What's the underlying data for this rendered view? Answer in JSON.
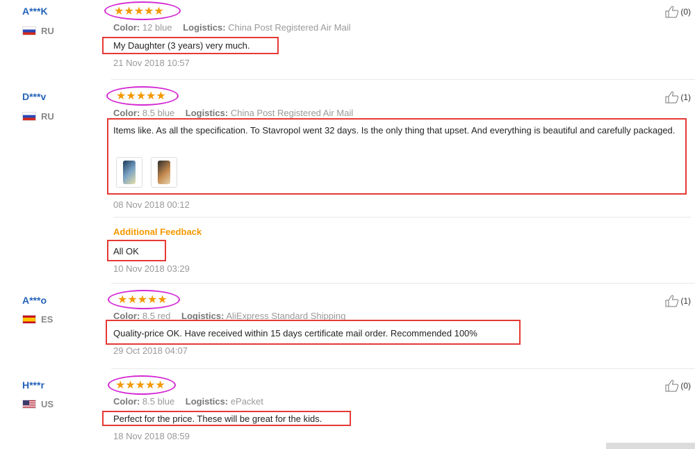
{
  "reviews": [
    {
      "name": "A***K",
      "country": "RU",
      "color_label": "Color:",
      "color_value": "12 blue",
      "logistics_label": "Logistics:",
      "logistics_value": "China Post Registered Air Mail",
      "text": "My Daughter (3 years) very much.",
      "date": "21 Nov 2018 10:57",
      "helpful": "(0)",
      "stars": "★★★★★"
    },
    {
      "name": "D***v",
      "country": "RU",
      "color_label": "Color:",
      "color_value": "8.5 blue",
      "logistics_label": "Logistics:",
      "logistics_value": "China Post Registered Air Mail",
      "text": "Items like. As all the specification. To Stavropol went 32 days. Is the only thing that upset. And everything is beautiful and carefully packaged.",
      "date": "08 Nov 2018 00:12",
      "helpful": "(1)",
      "stars": "★★★★★",
      "additional_label": "Additional Feedback",
      "additional_text": "All OK",
      "additional_date": "10 Nov 2018 03:29"
    },
    {
      "name": "A***o",
      "country": "ES",
      "color_label": "Color:",
      "color_value": "8.5 red",
      "logistics_label": "Logistics:",
      "logistics_value": "AliExpress Standard Shipping",
      "text": "Quality-price OK. Have received within 15 days certificate mail order. Recommended 100%",
      "date": "29 Oct 2018 04:07",
      "helpful": "(1)",
      "stars": "★★★★★"
    },
    {
      "name": "H***r",
      "country": "US",
      "color_label": "Color:",
      "color_value": "8.5 blue",
      "logistics_label": "Logistics:",
      "logistics_value": "ePacket",
      "text": "Perfect for the price. These will be great for the kids.",
      "date": "18 Nov 2018 08:59",
      "helpful": "(0)",
      "stars": "★★★★★"
    }
  ],
  "colors": {
    "name": "#2463b8",
    "star": "#f39800",
    "highlight_box": "#e53935",
    "star_ellipse": "#d42ad4",
    "additional": "#f39800"
  },
  "icons": [
    "thumbs-up-icon",
    "flag-icon",
    "star-icon"
  ]
}
